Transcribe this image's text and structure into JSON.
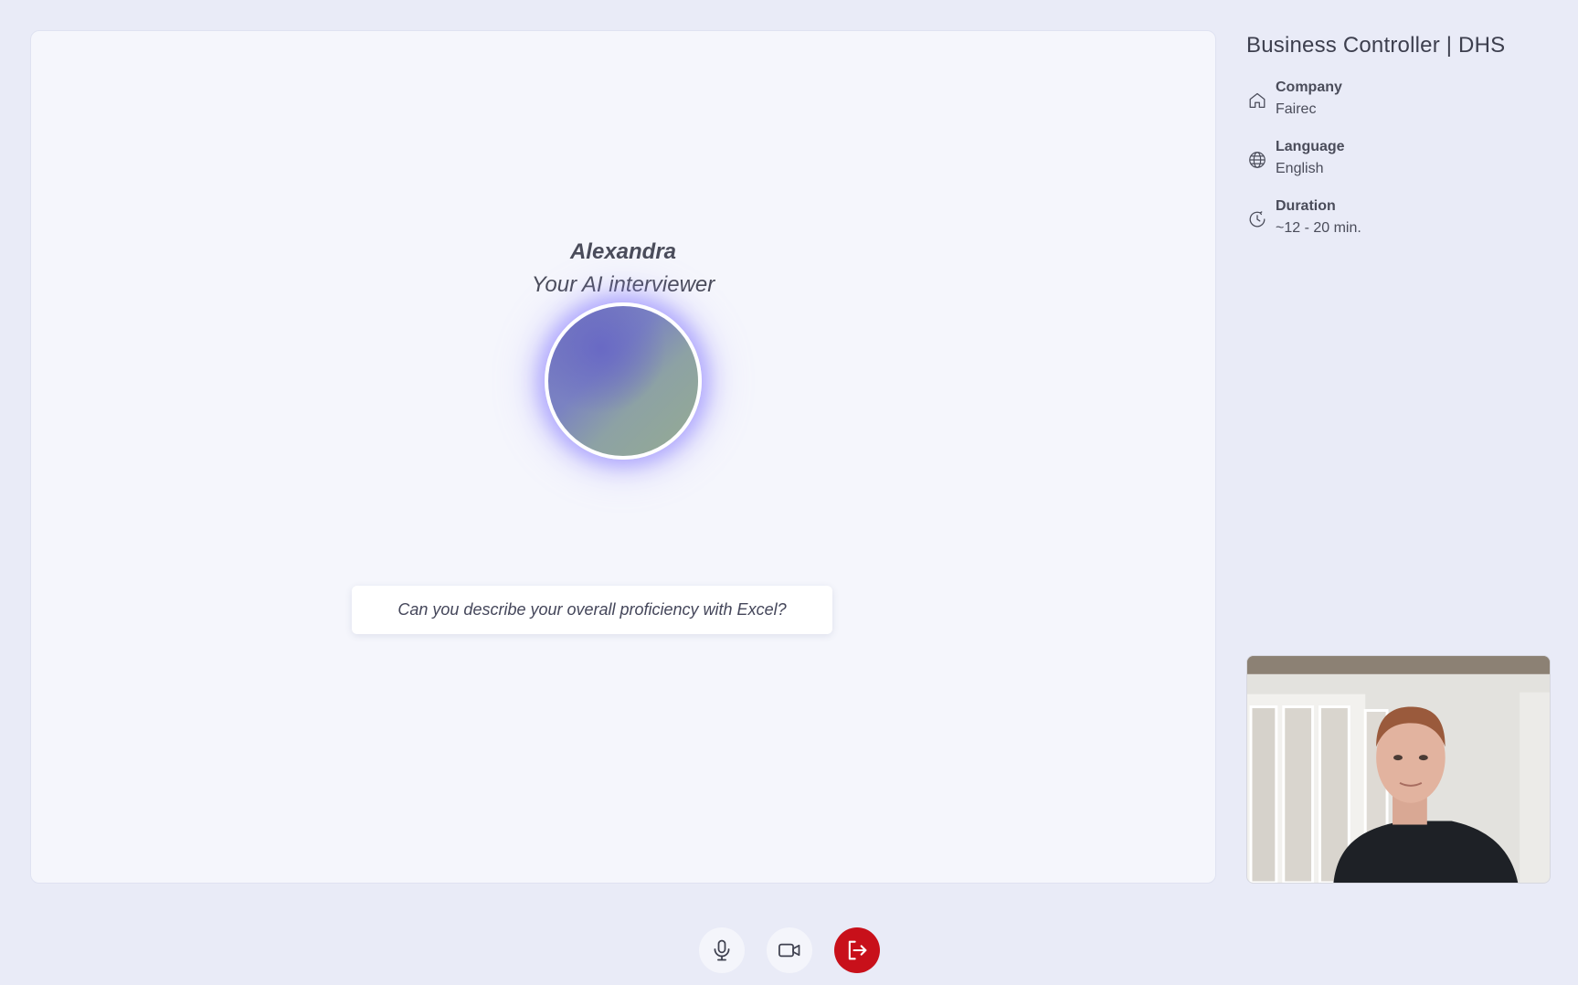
{
  "interviewer": {
    "name": "Alexandra",
    "role": "Your AI interviewer"
  },
  "question": {
    "text": "Can you describe your overall proficiency with Excel?"
  },
  "sidebar": {
    "job_title": "Business Controller | DHS",
    "items": [
      {
        "icon": "home-icon",
        "label": "Company",
        "value": "Fairec"
      },
      {
        "icon": "globe-icon",
        "label": "Language",
        "value": "English"
      },
      {
        "icon": "clock-history-icon",
        "label": "Duration",
        "value": "~12 - 20 min."
      }
    ]
  },
  "controls": [
    {
      "icon": "microphone-icon"
    },
    {
      "icon": "video-camera-icon"
    },
    {
      "icon": "leave-icon"
    }
  ],
  "colors": {
    "background": "#e9ebf7",
    "stage": "#f5f6fc",
    "leave_button": "#c8101a",
    "orb_glow": "#8478ff"
  }
}
